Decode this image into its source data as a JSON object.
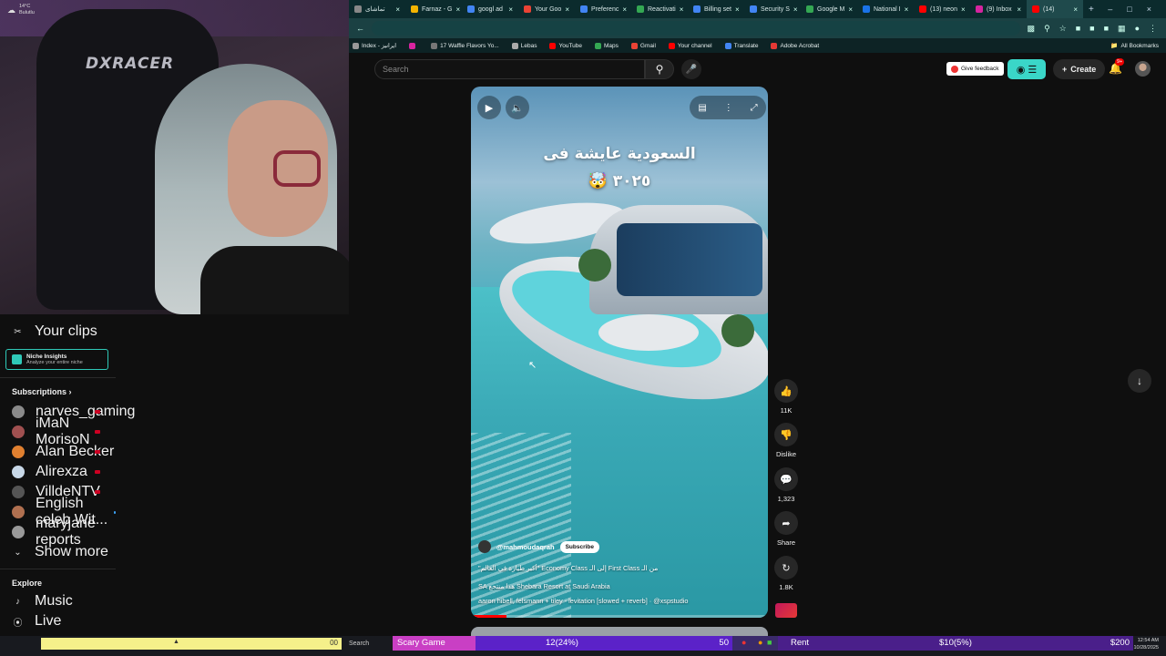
{
  "webcam": {
    "chair_brand": "DXRACER"
  },
  "browser": {
    "tabs": [
      {
        "title": "تماشای",
        "color": "#888"
      },
      {
        "title": "Farnaz - G",
        "color": "#f4b400"
      },
      {
        "title": "googl ad",
        "color": "#4285f4"
      },
      {
        "title": "Your Goo",
        "color": "#ea4335"
      },
      {
        "title": "Preferenc",
        "color": "#4285f4"
      },
      {
        "title": "Reactivati",
        "color": "#34a853"
      },
      {
        "title": "Billing set",
        "color": "#4285f4"
      },
      {
        "title": "Security S",
        "color": "#4285f4"
      },
      {
        "title": "Google M",
        "color": "#34a853"
      },
      {
        "title": "National I",
        "color": "#1a73e8"
      },
      {
        "title": "(13) neon",
        "color": "#f00"
      },
      {
        "title": "(9) Inbox",
        "color": "#d6249f"
      },
      {
        "title": "(14) ",
        "color": "#f00"
      }
    ],
    "bookmarks": [
      {
        "label": "Index - ایرانیز",
        "color": "#999"
      },
      {
        "label": "",
        "color": "#d6249f"
      },
      {
        "label": "17 Waffle Flavors Yo...",
        "color": "#777"
      },
      {
        "label": "Lebas",
        "color": "#aaa"
      },
      {
        "label": "YouTube",
        "color": "#f00"
      },
      {
        "label": "Maps",
        "color": "#34a853"
      },
      {
        "label": "Gmail",
        "color": "#ea4335"
      },
      {
        "label": "Your channel",
        "color": "#f00"
      },
      {
        "label": "Translate",
        "color": "#4285f4"
      },
      {
        "label": "Adobe Acrobat",
        "color": "#e53935"
      }
    ],
    "all_bookmarks": "All Bookmarks"
  },
  "yt": {
    "search_placeholder": "Search",
    "feedback": "Give feedback",
    "create": "Create",
    "notif_badge": "9+",
    "sidebar": {
      "your_clips": "Your clips",
      "niche_title": "Niche Insights",
      "niche_sub": "Analyze your entire niche",
      "subscriptions": "Subscriptions",
      "subs": [
        {
          "name": "narves_gaming",
          "color": "#8a8a8a",
          "live": true
        },
        {
          "name": "iMaN MorisoN",
          "color": "#a05050",
          "live": true
        },
        {
          "name": "Alan Becker",
          "color": "#e08030",
          "live": true
        },
        {
          "name": "Alirexza",
          "color": "#c8d8e8",
          "live": true
        },
        {
          "name": "VilldeNTV",
          "color": "#555",
          "live": true
        },
        {
          "name": "English celeb Wit...",
          "color": "#b07050",
          "live": false
        },
        {
          "name": "maryjane reports",
          "color": "#999",
          "live": false
        }
      ],
      "show_more": "Show more",
      "explore": "Explore",
      "explore_items": [
        "Music",
        "Live"
      ]
    },
    "short": {
      "title_line1": "السعودية عايشة فى",
      "title_line2": "٣٠٢٥ 🤯",
      "channel": "@mahmoudaqrah",
      "subscribe": "Subscribe",
      "desc1": "\"أكبر طيارة في العالم\" Economy Class إلى الـ First Class من الـ",
      "desc2": "SA هذا منتجع Shebara Resort at Saudi Arabia",
      "desc3": "aaron hibell, felsmann + tiley - levitation [slowed + reverb] · @xspstudio",
      "progress": 0.12
    },
    "actions": {
      "likes": "11K",
      "dislike": "Dislike",
      "comments": "1,323",
      "share": "Share",
      "remix": "1.8K"
    }
  },
  "overlay": {
    "weather_temp": "14°C",
    "weather_desc": "Bulutlu",
    "yellow_num": "00",
    "search": "Search",
    "cat1": "Scary Game",
    "cat2_pct": "12(24%)",
    "cat2_num": "50",
    "cat4_name": "Rent",
    "cat4_pct": "$10(5%)",
    "cat4_amt": "$200",
    "clock_time": "12:54 AM",
    "clock_date": "10/28/2025"
  }
}
